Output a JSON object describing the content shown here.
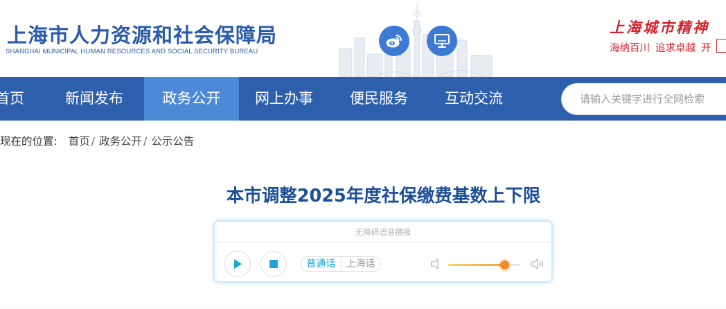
{
  "header": {
    "org_name_cn": "上海市人力资源和社会保障局",
    "org_name_en": "SHANGHAI MUNICIPAL HUMAN RESOURCES AND SOCIAL SECURITY BUREAU",
    "icons": [
      "weibo-icon",
      "desktop-icon"
    ],
    "spirit_title": "上海城市精神",
    "spirit_phrases": [
      "海纳百川",
      "追求卓越",
      "开"
    ]
  },
  "nav": {
    "items": [
      {
        "label": "首页"
      },
      {
        "label": "新闻发布"
      },
      {
        "label": "政务公开"
      },
      {
        "label": "网上办事"
      },
      {
        "label": "便民服务"
      },
      {
        "label": "互动交流"
      }
    ],
    "active_index": 2,
    "search_placeholder": "请输入关键字进行全网检索"
  },
  "breadcrumb": {
    "label": "现在的位置:",
    "items": [
      "首页",
      "政务公开",
      "公示公告"
    ],
    "separator": "/"
  },
  "article": {
    "title": "本市调整2025年度社保缴费基数上下限"
  },
  "player": {
    "header": "无障碍语音播报",
    "languages": [
      "普通话",
      "上海话"
    ],
    "selected_language": "普通话",
    "volume": 0.78
  },
  "colors": {
    "nav_bg": "#2d5fad",
    "nav_active": "#4e89d7",
    "brand_blue": "#2a5aa8",
    "title_blue": "#1d4f96",
    "accent_red": "#d2232a",
    "player_accent": "#16a7d6",
    "volume_knob": "#f08a24"
  }
}
